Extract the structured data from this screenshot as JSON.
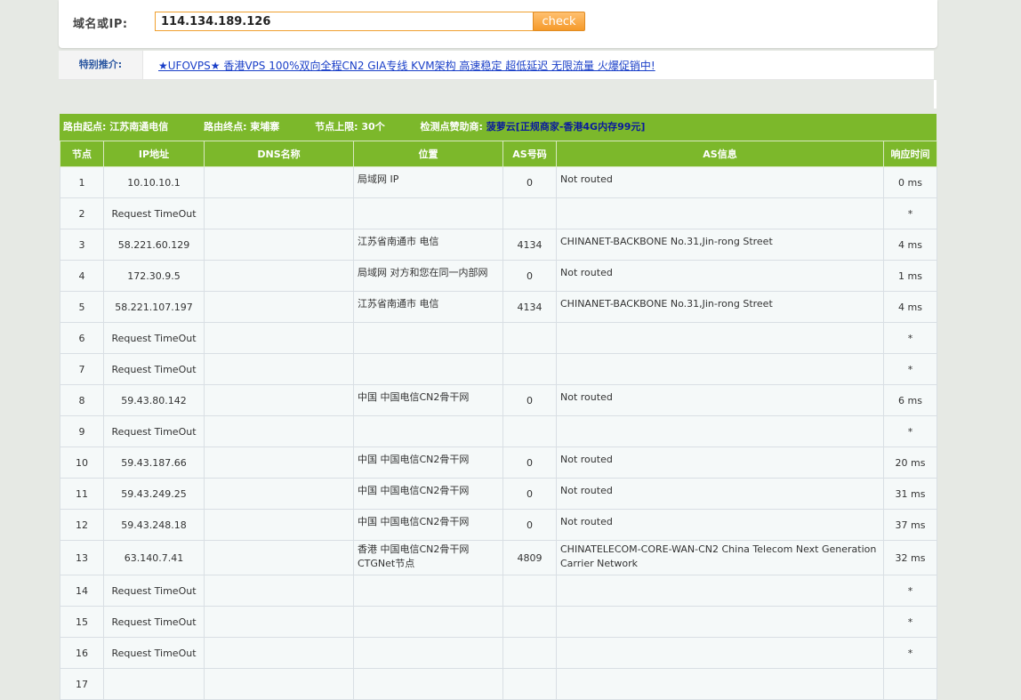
{
  "search": {
    "label": "域名或IP:",
    "value": "114.134.189.126",
    "check_label": "check"
  },
  "ad": {
    "label": "特别推介:",
    "link_text": "★UFOVPS★ 香港VPS 100%双向全程CN2 GIA专线 KVM架构 高速稳定 超低延迟 无限流量 火爆促销中!"
  },
  "trace_info": {
    "start": "路由起点: 江苏南通电信",
    "end": "路由终点: 柬埔寨",
    "limit": "节点上限: 30个",
    "sponsor_label": "检测点赞助商:",
    "sponsor_name": "菠萝云",
    "sponsor_deal": "[正规商家-香港4G内存99元]"
  },
  "columns": [
    "节点",
    "IP地址",
    "DNS名称",
    "位置",
    "AS号码",
    "AS信息",
    "响应时间"
  ],
  "hops": [
    {
      "hop": "1",
      "ip": "10.10.10.1",
      "dns": "",
      "loc": "局域网 IP",
      "asn": "0",
      "asinfo": "Not routed",
      "time": "0 ms"
    },
    {
      "hop": "2",
      "ip": "Request TimeOut",
      "dns": "",
      "loc": "",
      "asn": "",
      "asinfo": "",
      "time": "*"
    },
    {
      "hop": "3",
      "ip": "58.221.60.129",
      "dns": "",
      "loc": "江苏省南通市 电信",
      "asn": "4134",
      "asinfo": "CHINANET-BACKBONE No.31,Jin-rong Street",
      "time": "4 ms"
    },
    {
      "hop": "4",
      "ip": "172.30.9.5",
      "dns": "",
      "loc": "局域网 对方和您在同一内部网",
      "asn": "0",
      "asinfo": "Not routed",
      "time": "1 ms"
    },
    {
      "hop": "5",
      "ip": "58.221.107.197",
      "dns": "",
      "loc": "江苏省南通市 电信",
      "asn": "4134",
      "asinfo": "CHINANET-BACKBONE No.31,Jin-rong Street",
      "time": "4 ms"
    },
    {
      "hop": "6",
      "ip": "Request TimeOut",
      "dns": "",
      "loc": "",
      "asn": "",
      "asinfo": "",
      "time": "*"
    },
    {
      "hop": "7",
      "ip": "Request TimeOut",
      "dns": "",
      "loc": "",
      "asn": "",
      "asinfo": "",
      "time": "*"
    },
    {
      "hop": "8",
      "ip": "59.43.80.142",
      "dns": "",
      "loc": "中国 中国电信CN2骨干网",
      "asn": "0",
      "asinfo": "Not routed",
      "time": "6 ms"
    },
    {
      "hop": "9",
      "ip": "Request TimeOut",
      "dns": "",
      "loc": "",
      "asn": "",
      "asinfo": "",
      "time": "*"
    },
    {
      "hop": "10",
      "ip": "59.43.187.66",
      "dns": "",
      "loc": "中国 中国电信CN2骨干网",
      "asn": "0",
      "asinfo": "Not routed",
      "time": "20 ms"
    },
    {
      "hop": "11",
      "ip": "59.43.249.25",
      "dns": "",
      "loc": "中国 中国电信CN2骨干网",
      "asn": "0",
      "asinfo": "Not routed",
      "time": "31 ms"
    },
    {
      "hop": "12",
      "ip": "59.43.248.18",
      "dns": "",
      "loc": "中国 中国电信CN2骨干网",
      "asn": "0",
      "asinfo": "Not routed",
      "time": "37 ms"
    },
    {
      "hop": "13",
      "ip": "63.140.7.41",
      "dns": "",
      "loc": "香港 中国电信CN2骨干网CTGNet节点",
      "asn": "4809",
      "asinfo": "CHINATELECOM-CORE-WAN-CN2 China Telecom Next Generation Carrier Network",
      "time": "32 ms"
    },
    {
      "hop": "14",
      "ip": "Request TimeOut",
      "dns": "",
      "loc": "",
      "asn": "",
      "asinfo": "",
      "time": "*"
    },
    {
      "hop": "15",
      "ip": "Request TimeOut",
      "dns": "",
      "loc": "",
      "asn": "",
      "asinfo": "",
      "time": "*"
    },
    {
      "hop": "16",
      "ip": "Request TimeOut",
      "dns": "",
      "loc": "",
      "asn": "",
      "asinfo": "",
      "time": "*"
    },
    {
      "hop": "17",
      "ip": "",
      "dns": "",
      "loc": "",
      "asn": "",
      "asinfo": "",
      "time": ""
    }
  ]
}
